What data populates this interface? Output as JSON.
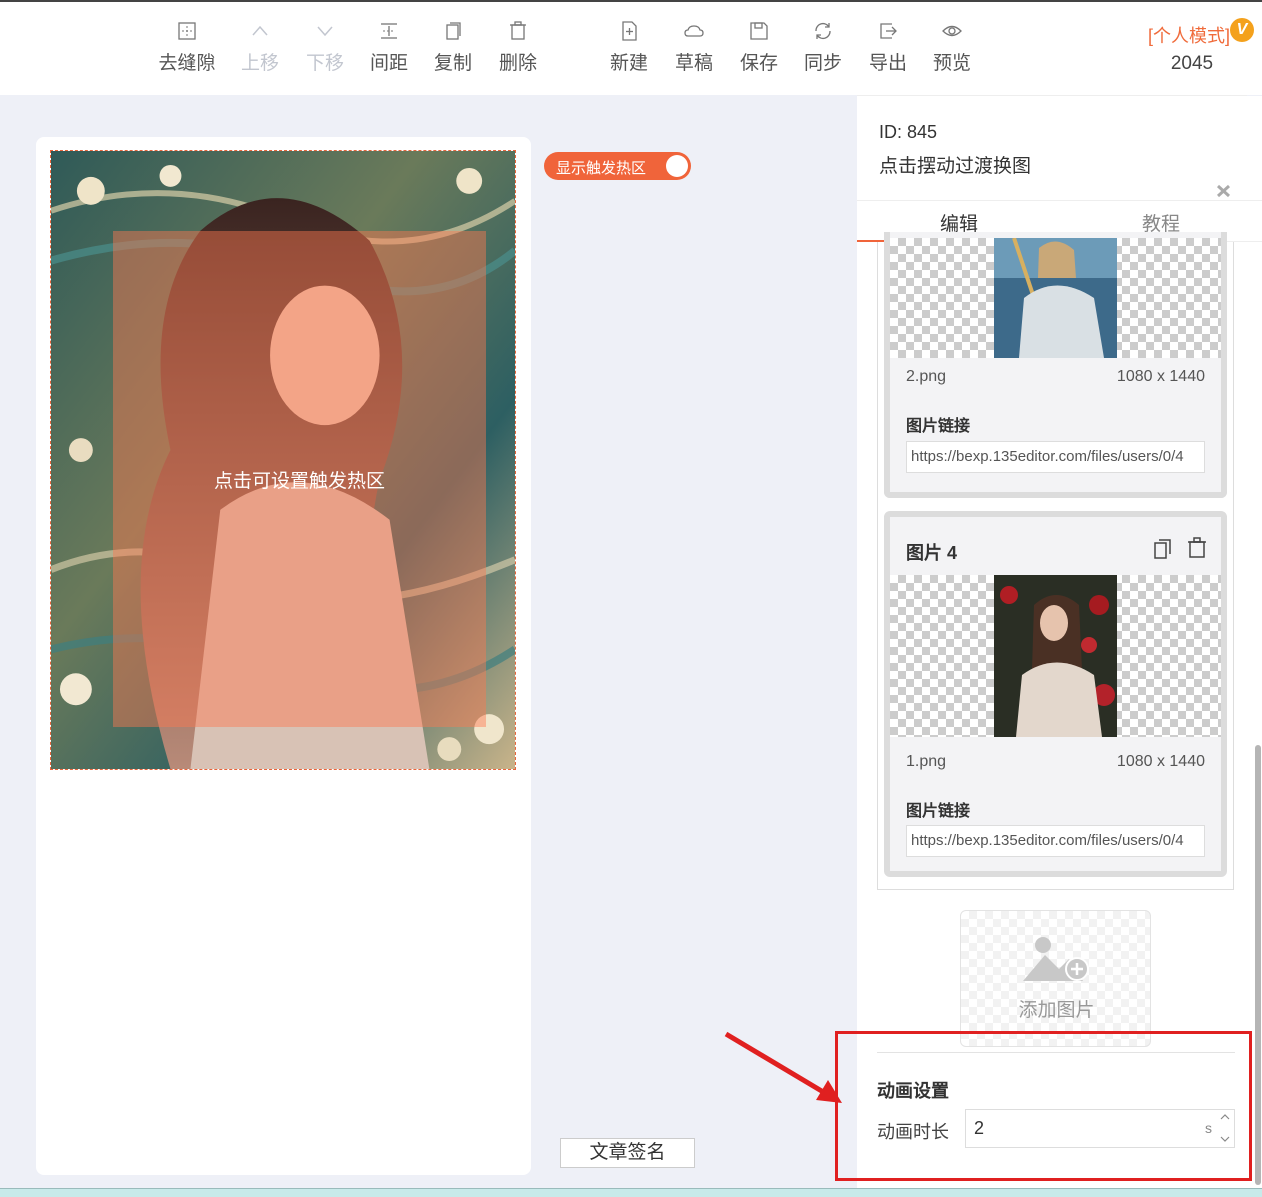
{
  "toolbar": {
    "items": [
      {
        "label": "去缝隙",
        "icon": "gap-remove-icon",
        "disabled": false
      },
      {
        "label": "上移",
        "icon": "move-up-icon",
        "disabled": true
      },
      {
        "label": "下移",
        "icon": "move-down-icon",
        "disabled": true
      },
      {
        "label": "间距",
        "icon": "spacing-icon",
        "disabled": false
      },
      {
        "label": "复制",
        "icon": "copy-icon",
        "disabled": false
      },
      {
        "label": "删除",
        "icon": "trash-icon",
        "disabled": false
      },
      {
        "label": "新建",
        "icon": "new-file-icon",
        "disabled": false
      },
      {
        "label": "草稿",
        "icon": "cloud-icon",
        "disabled": false
      },
      {
        "label": "保存",
        "icon": "save-icon",
        "disabled": false
      },
      {
        "label": "同步",
        "icon": "sync-icon",
        "disabled": false
      },
      {
        "label": "导出",
        "icon": "export-icon",
        "disabled": false
      },
      {
        "label": "预览",
        "icon": "eye-icon",
        "disabled": false
      }
    ],
    "mode_label": "[个人模式]",
    "vip_badge": "V",
    "count": "2045"
  },
  "canvas": {
    "toggle_label": "显示触发热区",
    "toggle_on": true,
    "hotzone_label": "点击可设置触发热区",
    "signature_button": "文章签名"
  },
  "panel": {
    "id_text": "ID: 845",
    "name": "点击摆动过渡换图",
    "tabs": [
      {
        "label": "编辑",
        "active": true
      },
      {
        "label": "教程",
        "active": false
      }
    ],
    "images": [
      {
        "title": "",
        "filename": "2.png",
        "dims": "1080 x 1440",
        "link_label": "图片链接",
        "link": "https://bexp.135editor.com/files/users/0/4"
      },
      {
        "title": "图片 4",
        "filename": "1.png",
        "dims": "1080 x 1440",
        "link_label": "图片链接",
        "link": "https://bexp.135editor.com/files/users/0/4"
      }
    ],
    "add_image_label": "添加图片",
    "animation": {
      "section_title": "动画设置",
      "duration_label": "动画时长",
      "duration_value": "2",
      "unit": "s"
    }
  },
  "colors": {
    "accent": "#f0643a",
    "highlight": "#e02020",
    "vip": "#f4a11c"
  }
}
